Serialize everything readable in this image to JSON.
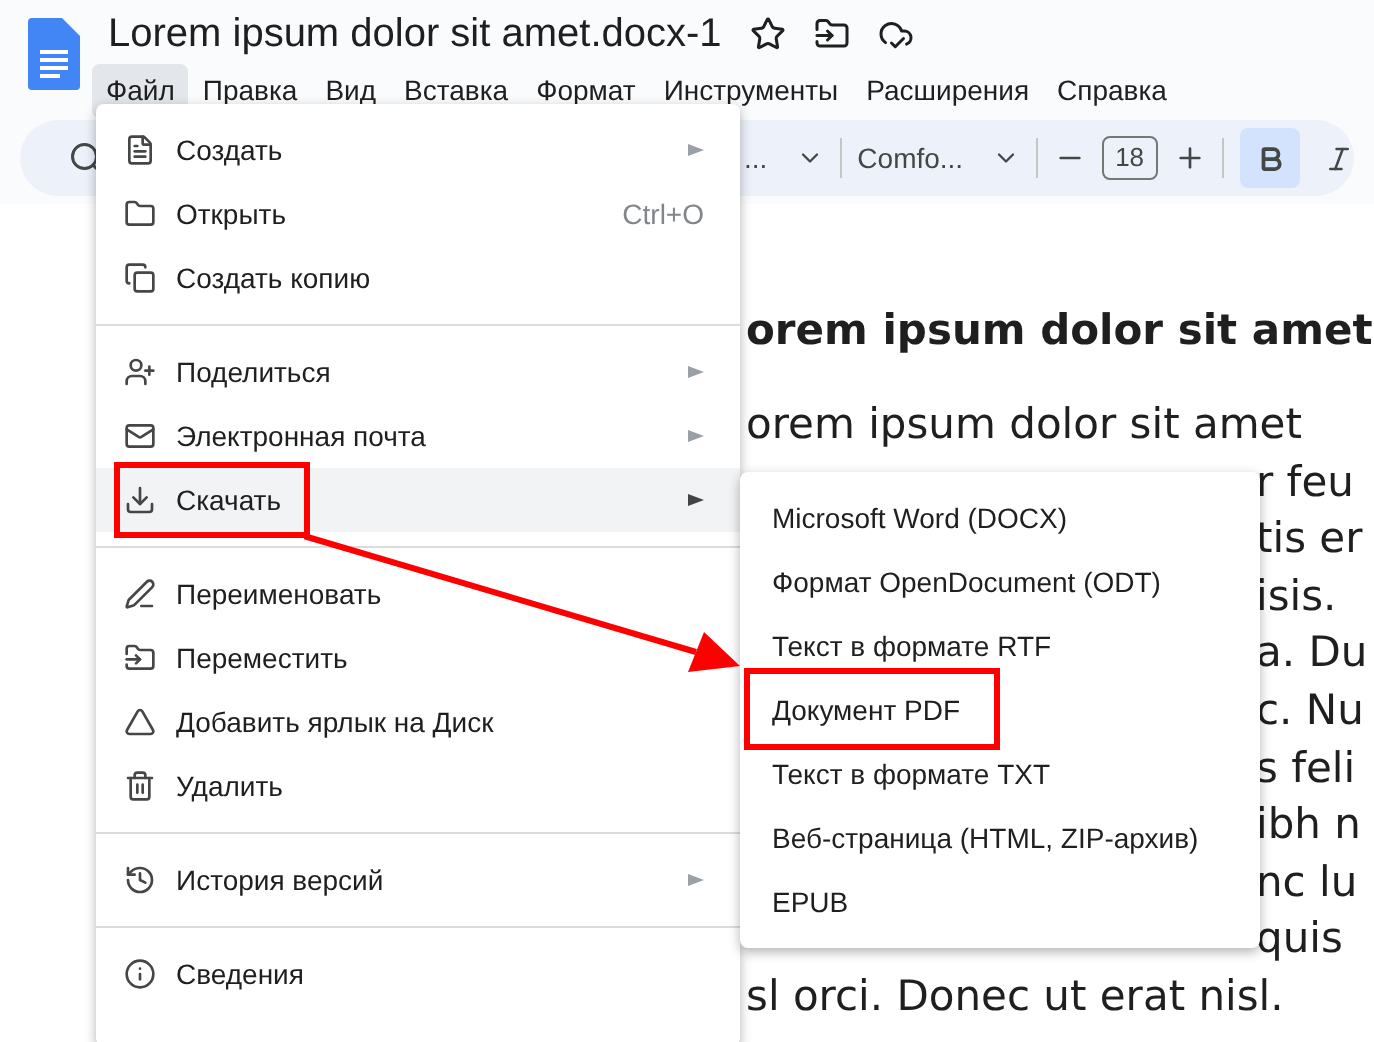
{
  "document_title": "Lorem ipsum dolor sit amet.docx-1",
  "menubar": [
    {
      "label": "Файл",
      "selected": true
    },
    {
      "label": "Правка",
      "selected": false
    },
    {
      "label": "Вид",
      "selected": false
    },
    {
      "label": "Вставка",
      "selected": false
    },
    {
      "label": "Формат",
      "selected": false
    },
    {
      "label": "Инструменты",
      "selected": false
    },
    {
      "label": "Расширения",
      "selected": false
    },
    {
      "label": "Справка",
      "selected": false
    }
  ],
  "toolbar": {
    "style_dropdown": "...",
    "font_dropdown": "Comfo...",
    "font_size": "18",
    "bold": {
      "selected": true
    }
  },
  "document": {
    "heading": "orem ipsum dolor sit amet",
    "lines": [
      {
        "kind": "full",
        "text": "orem ipsum dolor sit amet"
      },
      {
        "kind": "fragment",
        "text": "r feu"
      },
      {
        "kind": "fragment",
        "text": "tis er"
      },
      {
        "kind": "fragment",
        "text": "isis."
      },
      {
        "kind": "fragment",
        "text": "a. Du"
      },
      {
        "kind": "fragment",
        "text": "c. Nu"
      },
      {
        "kind": "fragment",
        "text": "s feli"
      },
      {
        "kind": "fragment",
        "text": "ibh n"
      },
      {
        "kind": "fragment",
        "text": "nc lu"
      },
      {
        "kind": "fragment",
        "text": "quis"
      },
      {
        "kind": "full",
        "text": "sl orci. Donec ut erat nisl."
      }
    ]
  },
  "file_menu": {
    "groups": [
      [
        {
          "label": "Создать",
          "submenu": true,
          "selected": false,
          "annotated": false
        },
        {
          "label": "Открыть",
          "shortcut": "Ctrl+O",
          "submenu": false,
          "selected": false,
          "annotated": false
        },
        {
          "label": "Создать копию",
          "submenu": false,
          "selected": false,
          "annotated": false
        }
      ],
      [
        {
          "label": "Поделиться",
          "submenu": true,
          "selected": false,
          "annotated": false
        },
        {
          "label": "Электронная почта",
          "submenu": true,
          "selected": false,
          "annotated": false
        },
        {
          "label": "Скачать",
          "submenu": true,
          "selected": true,
          "annotated": true
        }
      ],
      [
        {
          "label": "Переименовать",
          "submenu": false,
          "selected": false,
          "annotated": false
        },
        {
          "label": "Переместить",
          "submenu": false,
          "selected": false,
          "annotated": false
        },
        {
          "label": "Добавить ярлык на Диск",
          "submenu": false,
          "selected": false,
          "annotated": false
        },
        {
          "label": "Удалить",
          "submenu": false,
          "selected": false,
          "annotated": false
        }
      ],
      [
        {
          "label": "История версий",
          "submenu": true,
          "selected": false,
          "annotated": false
        }
      ],
      [
        {
          "label": "Сведения",
          "submenu": false,
          "selected": false,
          "annotated": false
        }
      ]
    ]
  },
  "download_submenu": [
    {
      "label": "Microsoft Word (DOCX)",
      "annotated": false
    },
    {
      "label": "Формат OpenDocument (ODT)",
      "annotated": false
    },
    {
      "label": "Текст в формате RTF",
      "annotated": false
    },
    {
      "label": "Документ PDF",
      "annotated": true
    },
    {
      "label": "Текст в формате TXT",
      "annotated": false
    },
    {
      "label": "Веб-страница (HTML, ZIP-архив)",
      "annotated": false
    },
    {
      "label": "EPUB",
      "annotated": false
    }
  ]
}
